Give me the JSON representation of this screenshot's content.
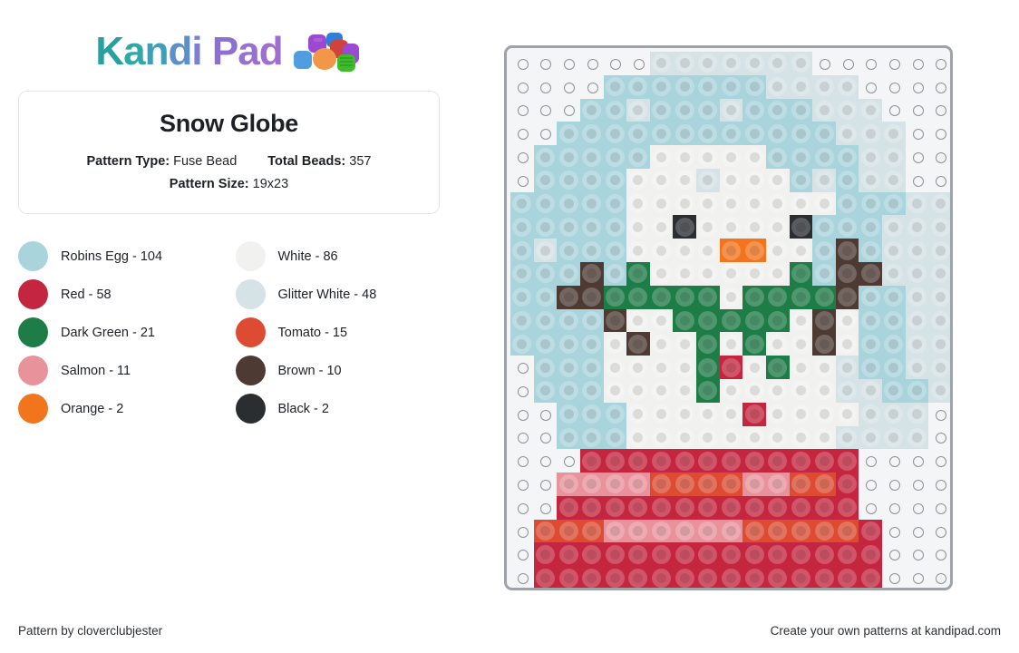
{
  "brand": {
    "name": "Kandi Pad",
    "letters": [
      "K",
      "a",
      "n",
      "d",
      "i",
      " ",
      "P",
      "a",
      "d"
    ],
    "beads_icon": "kandi-beads-icon"
  },
  "pattern": {
    "title": "Snow Globe",
    "type_label": "Pattern Type:",
    "type_value": "Fuse Bead",
    "total_label": "Total Beads:",
    "total_value": "357",
    "size_label": "Pattern Size:",
    "size_value": "19x23",
    "columns": 19,
    "rows": 23
  },
  "legend": {
    "items": [
      {
        "name": "Robins Egg",
        "count": "104",
        "label": "Robins Egg - 104",
        "hex": "#a9d4dc"
      },
      {
        "name": "White",
        "count": "86",
        "label": "White - 86",
        "hex": "#f1f1ef"
      },
      {
        "name": "Red",
        "count": "58",
        "label": "Red - 58",
        "hex": "#c4263f"
      },
      {
        "name": "Glitter White",
        "count": "48",
        "label": "Glitter White - 48",
        "hex": "#d5e2e6"
      },
      {
        "name": "Dark Green",
        "count": "21",
        "label": "Dark Green - 21",
        "hex": "#1e7c47"
      },
      {
        "name": "Tomato",
        "count": "15",
        "label": "Tomato - 15",
        "hex": "#dc4b32"
      },
      {
        "name": "Salmon",
        "count": "11",
        "label": "Salmon - 11",
        "hex": "#e8939c"
      },
      {
        "name": "Brown",
        "count": "10",
        "label": "Brown - 10",
        "hex": "#4c3a33"
      },
      {
        "name": "Orange",
        "count": "2",
        "label": "Orange - 2",
        "hex": "#f2741c"
      },
      {
        "name": "Black",
        "count": "2",
        "label": "Black - 2",
        "hex": "#2b2e31"
      }
    ]
  },
  "palette": {
    "_": "",
    "R": "#a9d4dc",
    "W": "#f1f1ef",
    "G": "#d5e2e6",
    "D": "#1e7c47",
    "B": "#4c3a33",
    "K": "#2b2e31",
    "O": "#f2741c",
    "E": "#c4263f",
    "T": "#dc4b32",
    "S": "#e8939c"
  },
  "grid_rows": [
    "______GGGGGGG______",
    "____RRRRRRRGGGG____",
    "___RRGRRRGRRRGGG___",
    "__RRRRRRRRRRRRGGG__",
    "_RRRRRWWWWWRRRRGG__",
    "_RRRRWWWGWWWRGRGG__",
    "RRRRRWWWWWWWWWRRRGG",
    "RRRRRWWKWWWWKRRRGGG",
    "RGRRRWWWWOOWWRBRGGG",
    "RRRBRDWWWWWWDRBBGGG",
    "RRBBDDDDDWDDDDBRRGG",
    "RRRRBWWDDDDDWBWRRGG",
    "RRRRWBWWDWDWWBWRRGG",
    "_RRRWWWWDEWDWWGRRGG",
    "_RRRWWWWDWWWWWGGRRG",
    "__RRRWWWWWEWWWWGGG_",
    "__RRRWWWWWWWWWGGGG_",
    "___EEEEEEEEEEEE____",
    "__SSSSTTTTSSTTE____",
    "__EEEEEEEEEEEEE____",
    "_TTTSSSSSSTTTTTE___",
    "_EEEEEEEEEEEEEEE___",
    "_EEEEEEEEEEEEEEE___"
  ],
  "footer": {
    "credit": "Pattern by cloverclubjester",
    "promo": "Create your own patterns at kandipad.com"
  }
}
